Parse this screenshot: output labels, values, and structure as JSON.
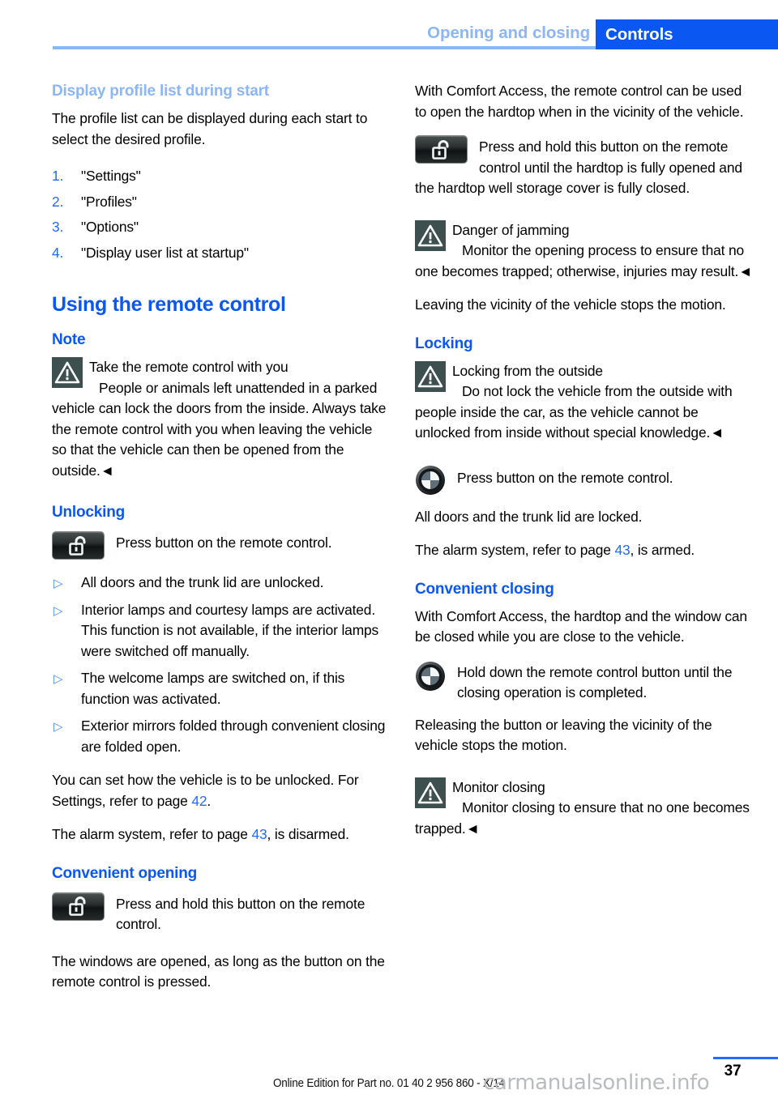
{
  "header": {
    "chapter": "Opening and closing",
    "section": "Controls",
    "accent_pale": "#8cb6f5",
    "accent_blue": "#0a57f2"
  },
  "left_column": {
    "profile_heading": "Display profile list during start",
    "profile_intro": "The profile list can be displayed during each start to select the desired profile.",
    "profile_steps": [
      {
        "num": "1.",
        "label": "\"Settings\""
      },
      {
        "num": "2.",
        "label": "\"Profiles\""
      },
      {
        "num": "3.",
        "label": "\"Options\""
      },
      {
        "num": "4.",
        "label": "\"Display user list at startup\""
      }
    ],
    "remote_heading": "Using the remote control",
    "note_heading": "Note",
    "note_title": "Take the remote control with you",
    "note_body": "People or animals left unattended in a parked vehicle can lock the doors from the inside. Always take the remote control with you when leaving the vehicle so that the vehicle can then be opened from the outside.◄",
    "unlocking_heading": "Unlocking",
    "unlocking_button_text": "Press button on the remote control.",
    "unlocking_bullets": [
      "All doors and the trunk lid are unlocked.",
      "Interior lamps and courtesy lamps are activated. This function is not available, if the interior lamps were switched off manually.",
      "The welcome lamps are switched on, if this function was activated.",
      "Exterior mirrors folded through convenient closing are folded open."
    ],
    "settings_text_a": "You can set how the vehicle is to be unlocked. For Settings, refer to page ",
    "settings_page": "42",
    "settings_text_b": ".",
    "alarm_text_a": "The alarm system, refer to page ",
    "alarm_page": "43",
    "alarm_text_b": ", is disarmed.",
    "conv_open_heading": "Convenient opening",
    "conv_open_button_text": "Press and hold this button on the remote control.",
    "conv_open_body": "The windows are opened, as long as the button on the remote control is pressed."
  },
  "right_column": {
    "comfort_intro": "With Comfort Access, the remote control can be used to open the hardtop when in the vicinity of the vehicle.",
    "comfort_button_text": "Press and hold this button on the remote control until the hardtop is fully opened and the hardtop well storage cover is fully closed.",
    "jam_title": "Danger of jamming",
    "jam_body": "Monitor the opening process to ensure that no one becomes trapped; otherwise, injuries may result.◄",
    "leaving_body": "Leaving the vicinity of the vehicle stops the motion.",
    "locking_heading": "Locking",
    "locking_warn_title": "Locking from the outside",
    "locking_warn_body": "Do not lock the vehicle from the outside with people inside the car, as the vehicle cannot be unlocked from inside without special knowledge.◄",
    "locking_button_text": "Press button on the remote control.",
    "locked_body": "All doors and the trunk lid are locked.",
    "alarm_text_a": "The alarm system, refer to page ",
    "alarm_page": "43",
    "alarm_text_b": ", is armed.",
    "conv_close_heading": "Convenient closing",
    "conv_close_intro": "With Comfort Access, the hardtop and the window can be closed while you are close to the vehicle.",
    "conv_close_button_text": "Hold down the remote control button until the closing operation is completed.",
    "releasing_body": "Releasing the button or leaving the vicinity of the vehicle stops the motion.",
    "monitor_title": "Monitor closing",
    "monitor_body": "Monitor closing to ensure that no one becomes trapped.◄"
  },
  "footer": {
    "page_number": "37",
    "edition": "Online Edition for Part no. 01 40 2 956 860 - X/14",
    "watermark": "carmanualsonline.info"
  }
}
